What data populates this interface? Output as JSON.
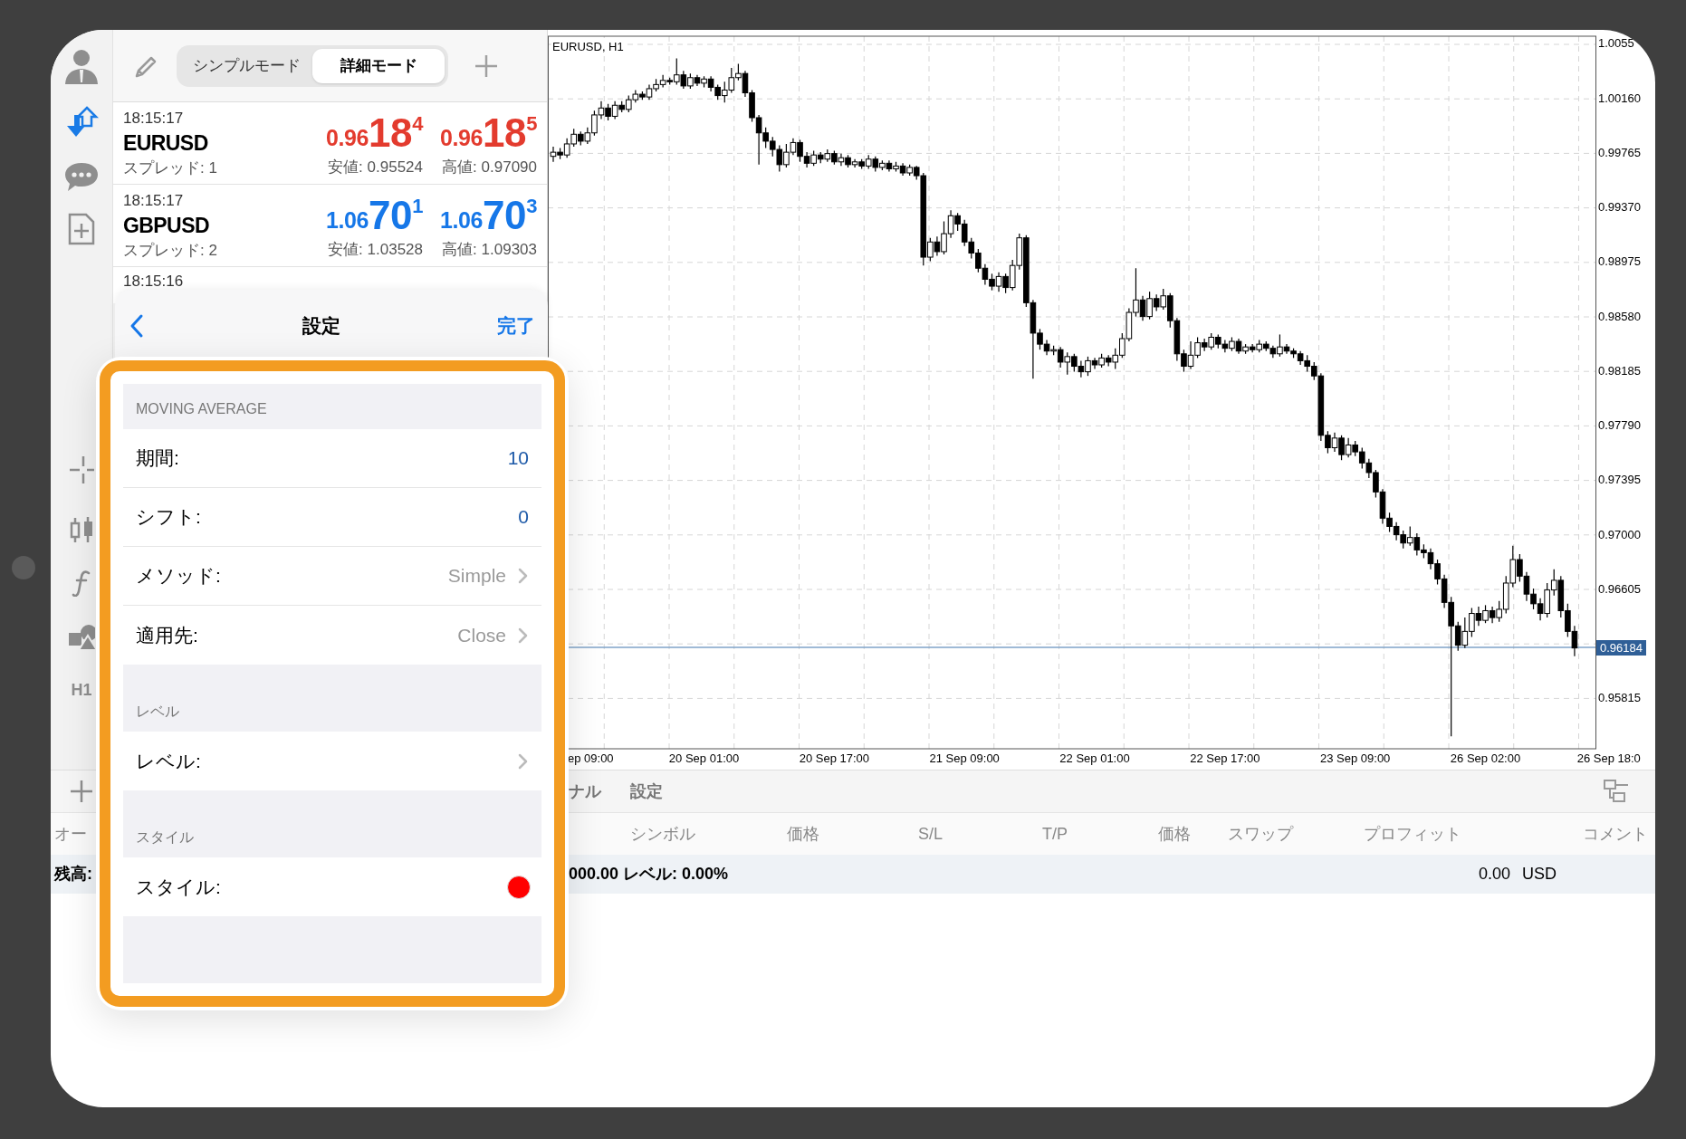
{
  "sidebar": {
    "timeframe": "H1"
  },
  "quotes": {
    "modes": [
      {
        "label": "シンプルモード",
        "selected": false
      },
      {
        "label": "詳細モード",
        "selected": true
      }
    ],
    "rows": [
      {
        "time": "18:15:17",
        "symbol": "EURUSD",
        "spread": "スプレッド: 1",
        "color": "#e33b2e",
        "bid": {
          "prefix": "0.96",
          "big": "18",
          "sup": "4"
        },
        "ask": {
          "prefix": "0.96",
          "big": "18",
          "sup": "5"
        },
        "low": "安値: 0.95524",
        "high": "高値: 0.97090"
      },
      {
        "time": "18:15:17",
        "symbol": "GBPUSD",
        "spread": "スプレッド: 2",
        "color": "#1677e8",
        "bid": {
          "prefix": "1.06",
          "big": "70",
          "sup": "1"
        },
        "ask": {
          "prefix": "1.06",
          "big": "70",
          "sup": "3"
        },
        "low": "安値: 1.03528",
        "high": "高値: 1.09303"
      }
    ],
    "partial_row_time": "18:15:16"
  },
  "chart": {
    "title": "EURUSD, H1",
    "partial_time_label": "ep 09:00",
    "chart_data": {
      "type": "candlestick",
      "ylim": [
        0.9545,
        1.0061
      ],
      "yticks": [
        {
          "value": 1.00555,
          "label": "1.0055"
        },
        {
          "value": 1.0016,
          "label": "1.00160"
        },
        {
          "value": 0.99765,
          "label": "0.99765"
        },
        {
          "value": 0.9937,
          "label": "0.99370"
        },
        {
          "value": 0.98975,
          "label": "0.98975"
        },
        {
          "value": 0.9858,
          "label": "0.98580"
        },
        {
          "value": 0.98185,
          "label": "0.98185"
        },
        {
          "value": 0.9779,
          "label": "0.97790"
        },
        {
          "value": 0.97395,
          "label": "0.97395"
        },
        {
          "value": 0.97,
          "label": "0.97000"
        },
        {
          "value": 0.96605,
          "label": "0.96605"
        },
        {
          "value": 0.95815,
          "label": "0.95815"
        }
      ],
      "grid": true,
      "ref_lines": [
        {
          "axis": "y",
          "value": 0.96184,
          "label": "0.96184",
          "color": "#7fa3c9"
        }
      ],
      "categories": [
        null,
        null,
        null,
        null,
        null,
        null,
        null,
        null,
        null,
        null,
        null,
        null,
        null,
        null,
        null,
        null,
        null,
        null,
        null,
        null,
        null,
        null,
        "20 Sep 01:00",
        null,
        null,
        null,
        null,
        null,
        null,
        null,
        null,
        null,
        null,
        null,
        null,
        null,
        null,
        null,
        null,
        null,
        null,
        "20 Sep 17:00",
        null,
        null,
        null,
        null,
        null,
        null,
        null,
        null,
        null,
        null,
        null,
        null,
        null,
        null,
        null,
        null,
        null,
        null,
        "21 Sep 09:00",
        null,
        null,
        null,
        null,
        null,
        null,
        null,
        null,
        null,
        null,
        null,
        null,
        null,
        null,
        null,
        null,
        null,
        null,
        "22 Sep 01:00",
        null,
        null,
        null,
        null,
        null,
        null,
        null,
        null,
        null,
        null,
        null,
        null,
        null,
        null,
        null,
        null,
        null,
        null,
        "22 Sep 17:00",
        null,
        null,
        null,
        null,
        null,
        null,
        null,
        null,
        null,
        null,
        null,
        null,
        null,
        null,
        null,
        null,
        null,
        null,
        "23 Sep 09:00",
        null,
        null,
        null,
        null,
        null,
        null,
        null,
        null,
        null,
        null,
        null,
        null,
        null,
        null,
        null,
        null,
        null,
        null,
        "26 Sep 02:00",
        null,
        null,
        null,
        null,
        null,
        null,
        null,
        null,
        null,
        null,
        null,
        null,
        null,
        null,
        null,
        null,
        null,
        "26 Sep 18:0"
      ],
      "ohlc": [
        [
          0.9974,
          0.9981,
          0.997,
          0.9977
        ],
        [
          0.9977,
          0.998,
          0.9972,
          0.9975
        ],
        [
          0.9975,
          0.9987,
          0.9973,
          0.9983
        ],
        [
          0.9983,
          0.9994,
          0.9981,
          0.999
        ],
        [
          0.999,
          0.9992,
          0.9982,
          0.9985
        ],
        [
          0.9985,
          0.9995,
          0.9983,
          0.9991
        ],
        [
          0.9991,
          1.0007,
          0.9989,
          1.0004
        ],
        [
          1.0004,
          1.0014,
          1.0001,
          1.0009
        ],
        [
          1.0009,
          1.0012,
          1.0,
          1.0003
        ],
        [
          1.0003,
          1.0014,
          1.0001,
          1.0011
        ],
        [
          1.0011,
          1.0014,
          1.0006,
          1.0008
        ],
        [
          1.0008,
          1.0018,
          1.0006,
          1.0015
        ],
        [
          1.0015,
          1.0022,
          1.0013,
          1.0019
        ],
        [
          1.0019,
          1.0021,
          1.0015,
          1.0017
        ],
        [
          1.0017,
          1.0026,
          1.0015,
          1.0023
        ],
        [
          1.0023,
          1.003,
          1.0021,
          1.0026
        ],
        [
          1.0026,
          1.0033,
          1.0024,
          1.0029
        ],
        [
          1.0029,
          1.0031,
          1.0026,
          1.0028
        ],
        [
          1.0028,
          1.0045,
          1.0026,
          1.0033
        ],
        [
          1.0033,
          1.0036,
          1.0023,
          1.0025
        ],
        [
          1.0025,
          1.0034,
          1.0023,
          1.0031
        ],
        [
          1.0031,
          1.0033,
          1.0025,
          1.0027
        ],
        [
          1.0027,
          1.0032,
          1.0024,
          1.003
        ],
        [
          1.003,
          1.0032,
          1.0021,
          1.0024
        ],
        [
          1.0024,
          1.0026,
          1.0015,
          1.0018
        ],
        [
          1.0018,
          1.0028,
          1.0013,
          1.0022
        ],
        [
          1.0022,
          1.0038,
          1.002,
          1.0031
        ],
        [
          1.0031,
          1.0041,
          1.0029,
          1.0034
        ],
        [
          1.0034,
          1.0036,
          1.0017,
          1.002
        ],
        [
          1.002,
          1.0022,
          0.9999,
          1.0002
        ],
        [
          1.0002,
          1.0004,
          0.9968,
          0.9991
        ],
        [
          0.9991,
          0.9995,
          0.998,
          0.9985
        ],
        [
          0.9985,
          0.9988,
          0.9974,
          0.9979
        ],
        [
          0.9979,
          0.9982,
          0.9963,
          0.9968
        ],
        [
          0.9968,
          0.9983,
          0.9966,
          0.9977
        ],
        [
          0.9977,
          0.9987,
          0.9975,
          0.9984
        ],
        [
          0.9984,
          0.9986,
          0.997,
          0.9974
        ],
        [
          0.9974,
          0.9977,
          0.9966,
          0.9969
        ],
        [
          0.9969,
          0.9978,
          0.9967,
          0.9975
        ],
        [
          0.9975,
          0.9977,
          0.9969,
          0.9972
        ],
        [
          0.9972,
          0.9979,
          0.997,
          0.9976
        ],
        [
          0.9976,
          0.9978,
          0.9968,
          0.997
        ],
        [
          0.997,
          0.9976,
          0.9967,
          0.9973
        ],
        [
          0.9973,
          0.9975,
          0.9966,
          0.9968
        ],
        [
          0.9968,
          0.9972,
          0.9966,
          0.997
        ],
        [
          0.997,
          0.9972,
          0.9965,
          0.9967
        ],
        [
          0.9967,
          0.9975,
          0.9965,
          0.9972
        ],
        [
          0.9972,
          0.9974,
          0.9963,
          0.9966
        ],
        [
          0.9966,
          0.9971,
          0.9964,
          0.9969
        ],
        [
          0.9969,
          0.9971,
          0.9963,
          0.9965
        ],
        [
          0.9965,
          0.997,
          0.9963,
          0.9967
        ],
        [
          0.9967,
          0.9969,
          0.996,
          0.9962
        ],
        [
          0.9962,
          0.9968,
          0.996,
          0.9966
        ],
        [
          0.9966,
          0.9967,
          0.9957,
          0.996
        ],
        [
          0.996,
          0.9962,
          0.9895,
          0.9901
        ],
        [
          0.9901,
          0.9915,
          0.9898,
          0.9912
        ],
        [
          0.9912,
          0.9916,
          0.9902,
          0.9905
        ],
        [
          0.9905,
          0.9927,
          0.9903,
          0.9918
        ],
        [
          0.9918,
          0.9935,
          0.9915,
          0.9931
        ],
        [
          0.9931,
          0.9933,
          0.992,
          0.9925
        ],
        [
          0.9925,
          0.9928,
          0.9909,
          0.9912
        ],
        [
          0.9912,
          0.9915,
          0.99,
          0.9904
        ],
        [
          0.9904,
          0.9907,
          0.989,
          0.9893
        ],
        [
          0.9893,
          0.9896,
          0.9881,
          0.9885
        ],
        [
          0.9885,
          0.9889,
          0.9877,
          0.988
        ],
        [
          0.988,
          0.989,
          0.9876,
          0.9887
        ],
        [
          0.9887,
          0.9889,
          0.9875,
          0.9879
        ],
        [
          0.9879,
          0.9899,
          0.9877,
          0.9895
        ],
        [
          0.9895,
          0.9918,
          0.9892,
          0.9915
        ],
        [
          0.9915,
          0.9917,
          0.9865,
          0.9868
        ],
        [
          0.9868,
          0.987,
          0.9813,
          0.9846
        ],
        [
          0.9846,
          0.9849,
          0.9834,
          0.9838
        ],
        [
          0.9838,
          0.9841,
          0.983,
          0.9833
        ],
        [
          0.9833,
          0.9837,
          0.983,
          0.9834
        ],
        [
          0.9834,
          0.9836,
          0.9821,
          0.9825
        ],
        [
          0.9825,
          0.9832,
          0.9816,
          0.9829
        ],
        [
          0.9829,
          0.9831,
          0.9818,
          0.9822
        ],
        [
          0.9822,
          0.9826,
          0.9814,
          0.9818
        ],
        [
          0.9818,
          0.9829,
          0.9815,
          0.9826
        ],
        [
          0.9826,
          0.9828,
          0.982,
          0.9823
        ],
        [
          0.9823,
          0.9831,
          0.9821,
          0.9828
        ],
        [
          0.9828,
          0.983,
          0.9822,
          0.9825
        ],
        [
          0.9825,
          0.9835,
          0.982,
          0.983
        ],
        [
          0.983,
          0.9846,
          0.9828,
          0.9842
        ],
        [
          0.9842,
          0.9864,
          0.984,
          0.9861
        ],
        [
          0.9861,
          0.9893,
          0.9858,
          0.987
        ],
        [
          0.987,
          0.9873,
          0.9855,
          0.9858
        ],
        [
          0.9858,
          0.9876,
          0.9856,
          0.9871
        ],
        [
          0.9871,
          0.9874,
          0.9862,
          0.9865
        ],
        [
          0.9865,
          0.9878,
          0.9863,
          0.9873
        ],
        [
          0.9873,
          0.9875,
          0.985,
          0.9855
        ],
        [
          0.9855,
          0.9857,
          0.9826,
          0.9831
        ],
        [
          0.9831,
          0.9834,
          0.9818,
          0.9822
        ],
        [
          0.9822,
          0.984,
          0.982,
          0.983
        ],
        [
          0.983,
          0.9843,
          0.9828,
          0.9839
        ],
        [
          0.9839,
          0.9842,
          0.9833,
          0.9836
        ],
        [
          0.9836,
          0.9846,
          0.9834,
          0.9843
        ],
        [
          0.9843,
          0.9845,
          0.9835,
          0.9838
        ],
        [
          0.9838,
          0.9841,
          0.9832,
          0.9835
        ],
        [
          0.9835,
          0.9843,
          0.9833,
          0.984
        ],
        [
          0.984,
          0.9842,
          0.9831,
          0.9833
        ],
        [
          0.9833,
          0.9838,
          0.9831,
          0.9836
        ],
        [
          0.9836,
          0.9838,
          0.9832,
          0.9834
        ],
        [
          0.9834,
          0.9841,
          0.9832,
          0.9838
        ],
        [
          0.9838,
          0.984,
          0.9833,
          0.9835
        ],
        [
          0.9835,
          0.9837,
          0.9828,
          0.9831
        ],
        [
          0.9831,
          0.9845,
          0.9829,
          0.9836
        ],
        [
          0.9836,
          0.9838,
          0.9831,
          0.9833
        ],
        [
          0.9833,
          0.9835,
          0.9828,
          0.9831
        ],
        [
          0.9831,
          0.9833,
          0.9823,
          0.9826
        ],
        [
          0.9826,
          0.983,
          0.9818,
          0.9822
        ],
        [
          0.9822,
          0.9825,
          0.9812,
          0.9815
        ],
        [
          0.9815,
          0.9817,
          0.9768,
          0.9772
        ],
        [
          0.9772,
          0.9775,
          0.9759,
          0.9763
        ],
        [
          0.9763,
          0.9774,
          0.976,
          0.977
        ],
        [
          0.977,
          0.9772,
          0.9754,
          0.9758
        ],
        [
          0.9758,
          0.977,
          0.9756,
          0.9765
        ],
        [
          0.9765,
          0.9768,
          0.9757,
          0.976
        ],
        [
          0.976,
          0.9763,
          0.9748,
          0.9752
        ],
        [
          0.9752,
          0.9755,
          0.9741,
          0.9745
        ],
        [
          0.9745,
          0.9747,
          0.9727,
          0.9731
        ],
        [
          0.9731,
          0.9733,
          0.9708,
          0.9712
        ],
        [
          0.9712,
          0.9716,
          0.9702,
          0.9706
        ],
        [
          0.9706,
          0.9709,
          0.9696,
          0.97
        ],
        [
          0.97,
          0.9703,
          0.969,
          0.9694
        ],
        [
          0.9694,
          0.9706,
          0.9692,
          0.9698
        ],
        [
          0.9698,
          0.9701,
          0.9685,
          0.9689
        ],
        [
          0.9689,
          0.9693,
          0.9683,
          0.9687
        ],
        [
          0.9687,
          0.969,
          0.9675,
          0.9679
        ],
        [
          0.9679,
          0.9682,
          0.9664,
          0.9668
        ],
        [
          0.9668,
          0.9671,
          0.9647,
          0.9651
        ],
        [
          0.9651,
          0.9655,
          0.9554,
          0.9634
        ],
        [
          0.9634,
          0.9637,
          0.9616,
          0.962
        ],
        [
          0.962,
          0.964,
          0.9618,
          0.963
        ],
        [
          0.963,
          0.9647,
          0.9626,
          0.9643
        ],
        [
          0.9643,
          0.9648,
          0.9634,
          0.9638
        ],
        [
          0.9638,
          0.9649,
          0.9636,
          0.9645
        ],
        [
          0.9645,
          0.9648,
          0.9636,
          0.964
        ],
        [
          0.964,
          0.9652,
          0.9637,
          0.9646
        ],
        [
          0.9646,
          0.967,
          0.9643,
          0.9665
        ],
        [
          0.9665,
          0.9692,
          0.9662,
          0.9682
        ],
        [
          0.9682,
          0.9686,
          0.9666,
          0.967
        ],
        [
          0.967,
          0.9673,
          0.9652,
          0.9657
        ],
        [
          0.9657,
          0.9661,
          0.9646,
          0.965
        ],
        [
          0.965,
          0.9654,
          0.9638,
          0.9643
        ],
        [
          0.9643,
          0.9665,
          0.964,
          0.966
        ],
        [
          0.966,
          0.9675,
          0.9656,
          0.9667
        ],
        [
          0.9667,
          0.967,
          0.964,
          0.9645
        ],
        [
          0.9645,
          0.965,
          0.9626,
          0.963
        ],
        [
          0.963,
          0.9634,
          0.9612,
          0.9618
        ],
        null,
        null,
        null,
        null,
        null
      ]
    }
  },
  "settings": {
    "title": "設定",
    "done": "完了",
    "sections": [
      {
        "header": "MOVING AVERAGE",
        "rows": [
          {
            "kind": "number",
            "label": "期間:",
            "value": "10"
          },
          {
            "kind": "number",
            "label": "シフト:",
            "value": "0"
          },
          {
            "kind": "choice",
            "label": "メソッド:",
            "value": "Simple"
          },
          {
            "kind": "choice",
            "label": "適用先:",
            "value": "Close"
          }
        ]
      },
      {
        "header": "レベル",
        "rows": [
          {
            "kind": "choice",
            "label": "レベル:"
          }
        ]
      },
      {
        "header": "スタイル",
        "rows": [
          {
            "kind": "color",
            "label": "スタイル:",
            "color": "#ff0000"
          }
        ]
      }
    ]
  },
  "terminal": {
    "tabs": [
      "ナル",
      "設定"
    ],
    "left_header": "オー",
    "columns": [
      "シンボル",
      "価格",
      "S/L",
      "T/P",
      "価格",
      "スワップ",
      "プロフィット",
      "コメント"
    ],
    "balance": {
      "label": "残高:",
      "text": "000.00 レベル: 0.00%",
      "profit": "0.00",
      "currency": "USD"
    }
  }
}
